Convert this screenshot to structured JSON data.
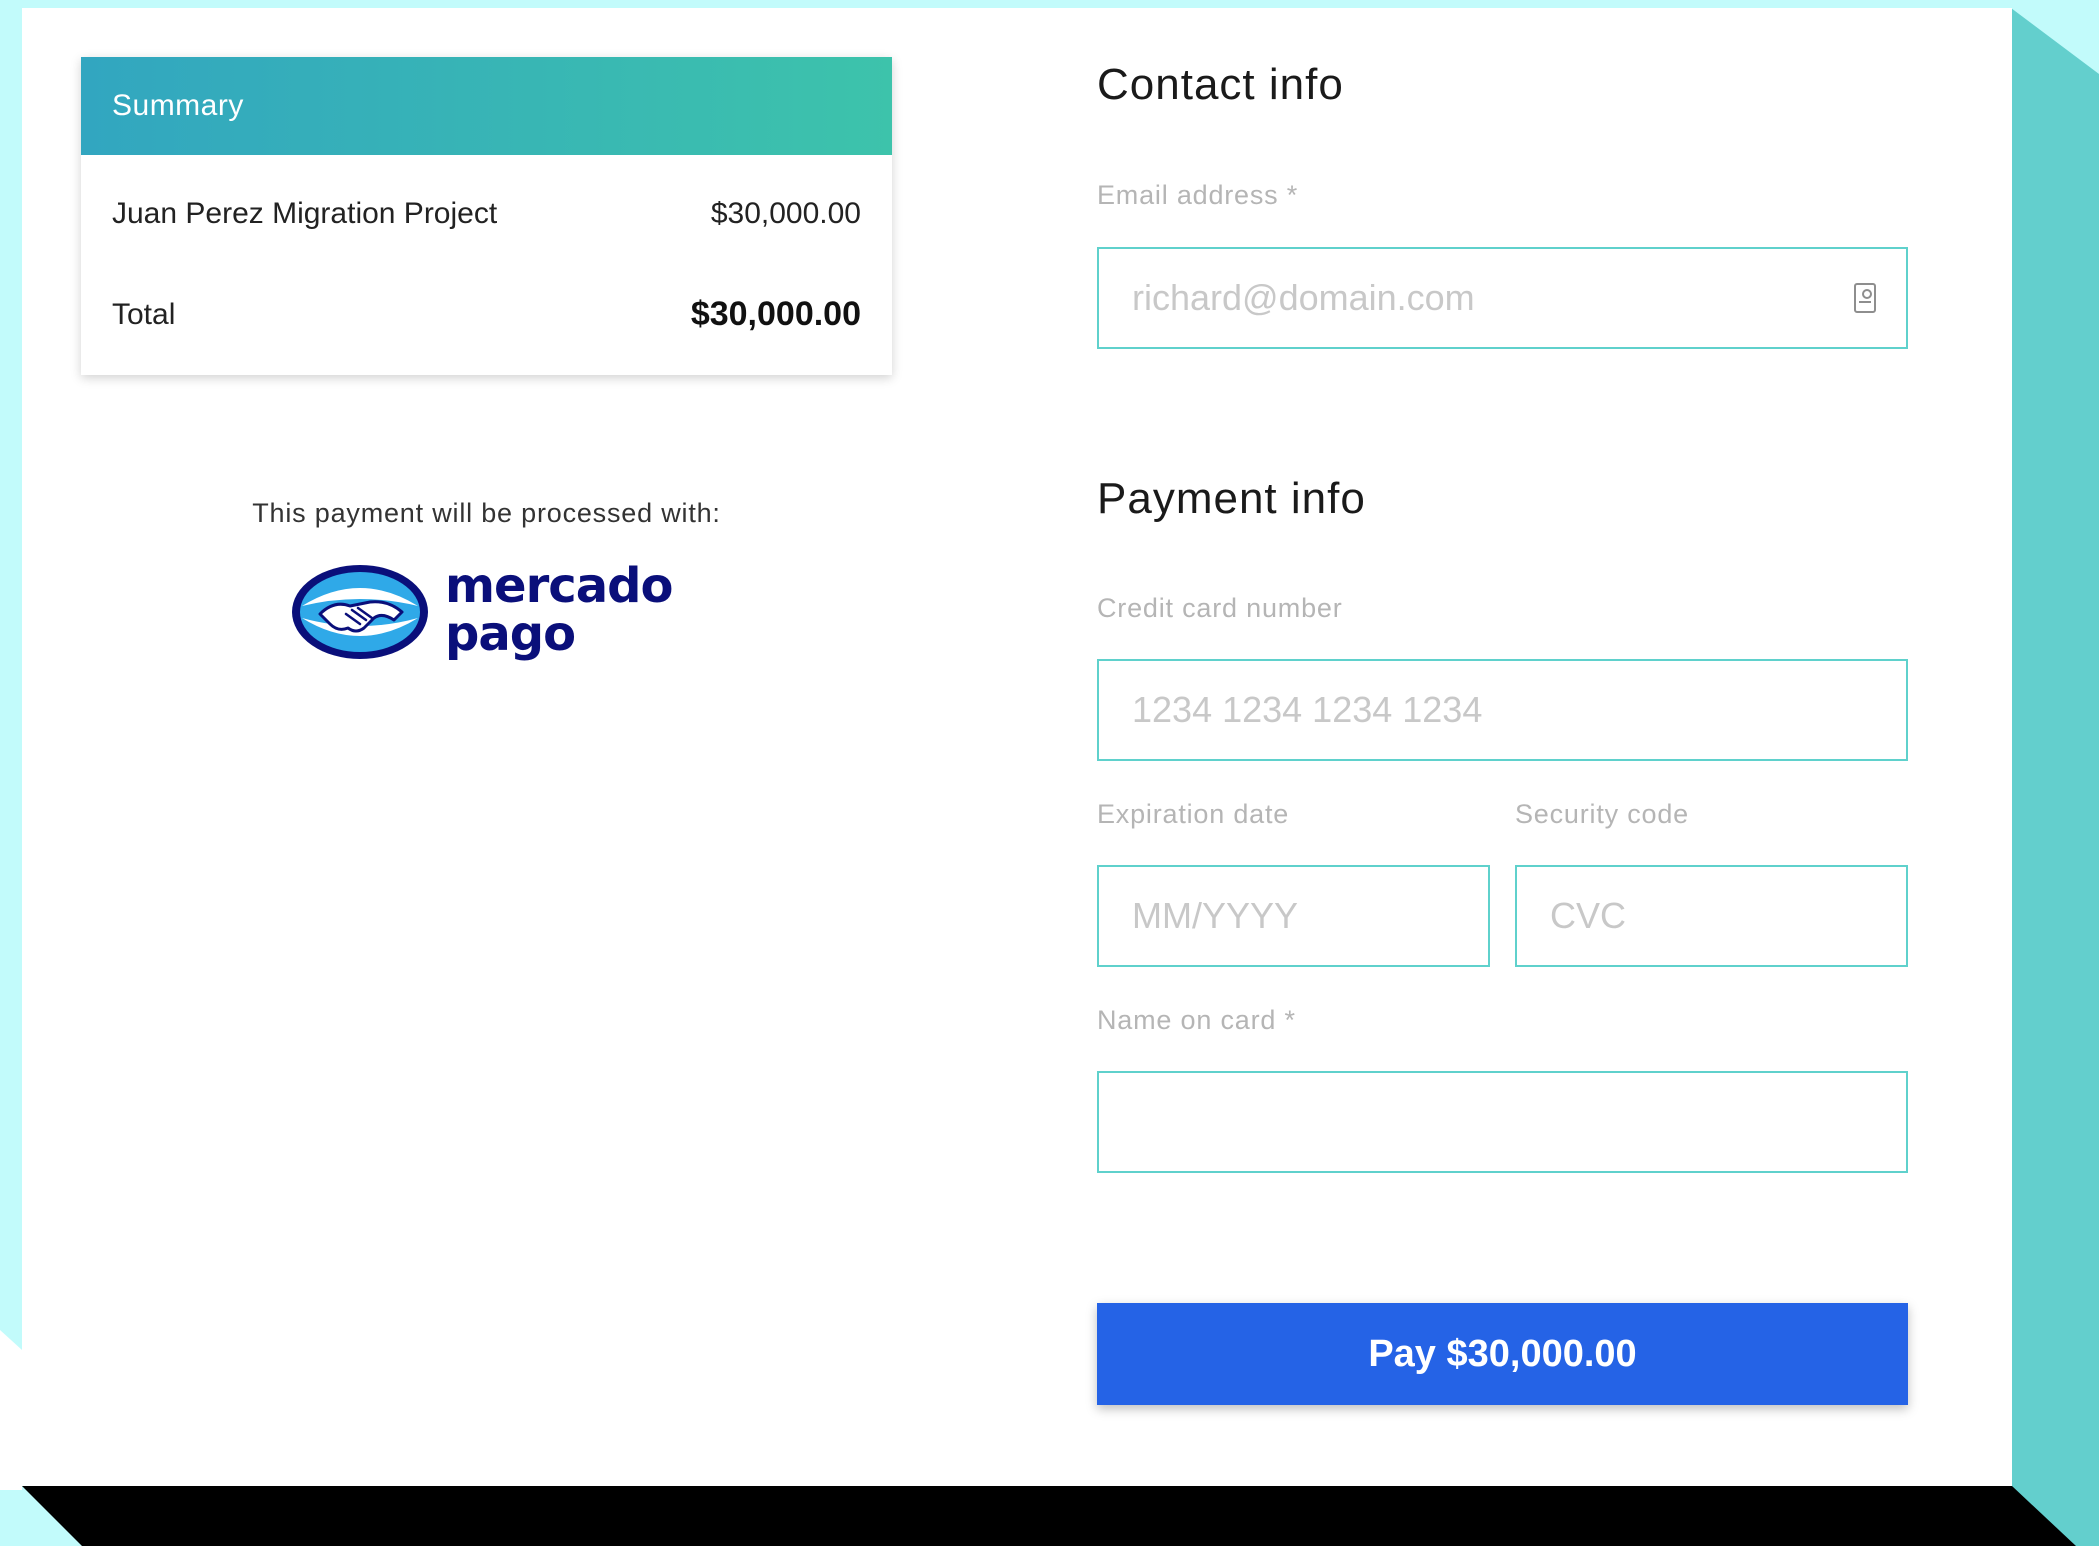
{
  "summary": {
    "header": "Summary",
    "item_name": "Juan Perez Migration Project",
    "item_amount": "$30,000.00",
    "total_label": "Total",
    "total_amount": "$30,000.00"
  },
  "processor": {
    "text": "This payment will be processed with:",
    "logo_name": "mercado pago",
    "logo_line1": "mercado",
    "logo_line2": "pago"
  },
  "contact": {
    "title": "Contact info",
    "email_label": "Email address *",
    "email_placeholder": "richard@domain.com",
    "email_icon": "contact-card-icon"
  },
  "payment": {
    "title": "Payment info",
    "card_label": "Credit card number",
    "card_placeholder": "1234 1234 1234 1234",
    "exp_label": "Expiration date",
    "exp_placeholder": "MM/YYYY",
    "cvc_label": "Security code",
    "cvc_placeholder": "CVC",
    "name_label": "Name on card *",
    "name_value": ""
  },
  "pay_button": {
    "label": "Pay $30,000.00"
  },
  "colors": {
    "accent_border": "#5fd1cc",
    "button": "#2563e6",
    "header_gradient_start": "#32a6c0",
    "header_gradient_end": "#3dc3ab",
    "background": "#c2fbfb",
    "mercado_pago_blue": "#0a0f7a"
  }
}
